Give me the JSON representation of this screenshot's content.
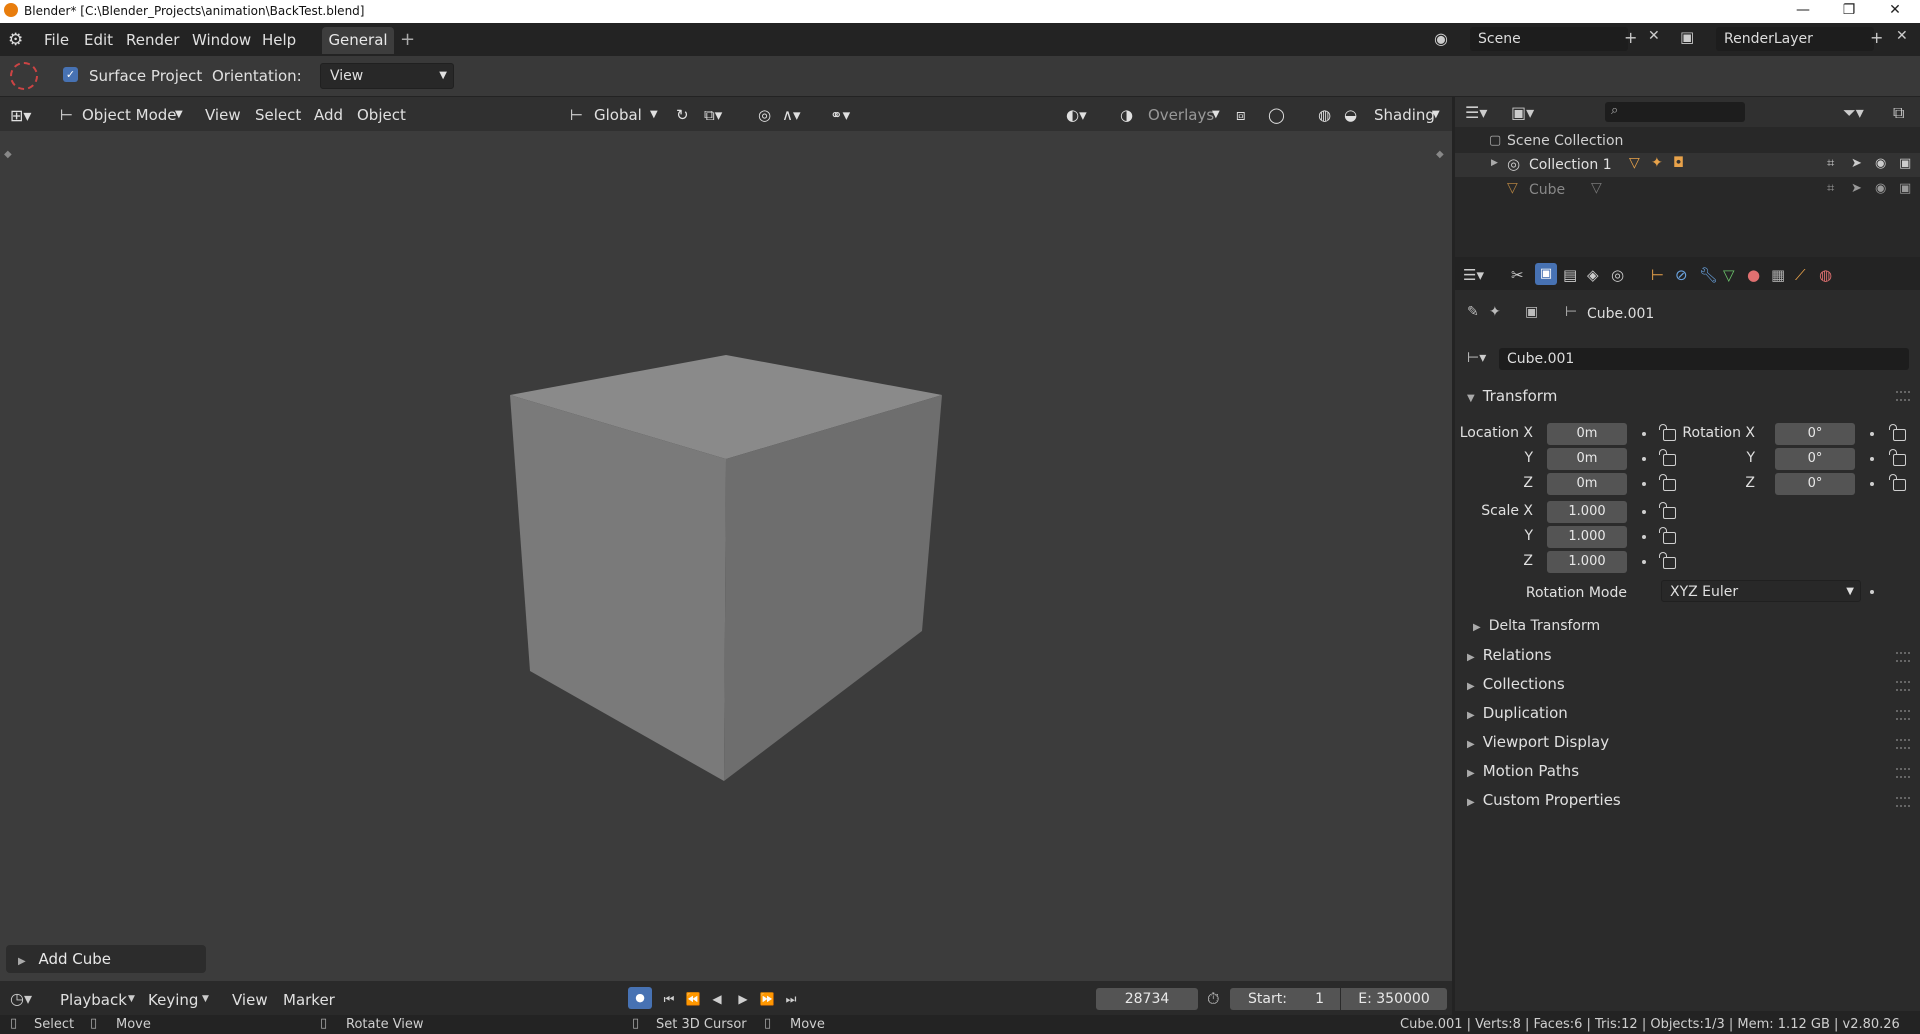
{
  "window": {
    "title": "Blender* [C:\\Blender_Projects\\animation\\BackTest.blend]",
    "minimize": "—",
    "maximize": "❐",
    "close": "✕"
  },
  "menu": [
    "File",
    "Edit",
    "Render",
    "Window",
    "Help"
  ],
  "workspace": {
    "tab": "General",
    "add": "+"
  },
  "scene": {
    "name": "Scene",
    "render_layer": "RenderLayer"
  },
  "tool_settings": {
    "surface_project": "Surface Project",
    "orientation_label": "Orientation:",
    "orientation_value": "View"
  },
  "viewport_header": {
    "mode": "Object Mode",
    "menus": [
      "View",
      "Select",
      "Add",
      "Object"
    ],
    "transform_orientation": "Global",
    "overlays": "Overlays",
    "shading": "Shading"
  },
  "outliner": {
    "scene_collection": "Scene Collection",
    "collection": "Collection 1",
    "object": "Cube",
    "search_placeholder": ""
  },
  "properties": {
    "object_breadcrumb": "Cube.001",
    "object_name": "Cube.001",
    "transform_header": "Transform",
    "location_x_label": "Location X",
    "y_label": "Y",
    "z_label": "Z",
    "rotation_x_label": "Rotation X",
    "scale_x_label": "Scale X",
    "location": [
      "0m",
      "0m",
      "0m"
    ],
    "rotation": [
      "0°",
      "0°",
      "0°"
    ],
    "scale": [
      "1.000",
      "1.000",
      "1.000"
    ],
    "rotation_mode_label": "Rotation Mode",
    "rotation_mode": "XYZ Euler",
    "delta_transform": "Delta Transform",
    "panels": [
      "Relations",
      "Collections",
      "Duplication",
      "Viewport Display",
      "Motion Paths",
      "Custom Properties"
    ]
  },
  "operator_panel": {
    "label": "Add Cube"
  },
  "timeline": {
    "menus": [
      "Playback",
      "Keying",
      "View",
      "Marker"
    ],
    "current_frame": "28734",
    "start_label": "Start:",
    "start_value": "1",
    "end": "E: 350000"
  },
  "status": {
    "select": "Select",
    "move": "Move",
    "rotate_view": "Rotate View",
    "set_cursor": "Set 3D Cursor",
    "move2": "Move",
    "info": "Cube.001 | Verts:8 | Faces:6 | Tris:12 | Objects:1/3 | Mem: 1.12 GB | v2.80.26"
  },
  "colors": {
    "accent": "#4772b3",
    "orange": "#e87d0d",
    "viewport_bg": "#3c3c3c"
  }
}
